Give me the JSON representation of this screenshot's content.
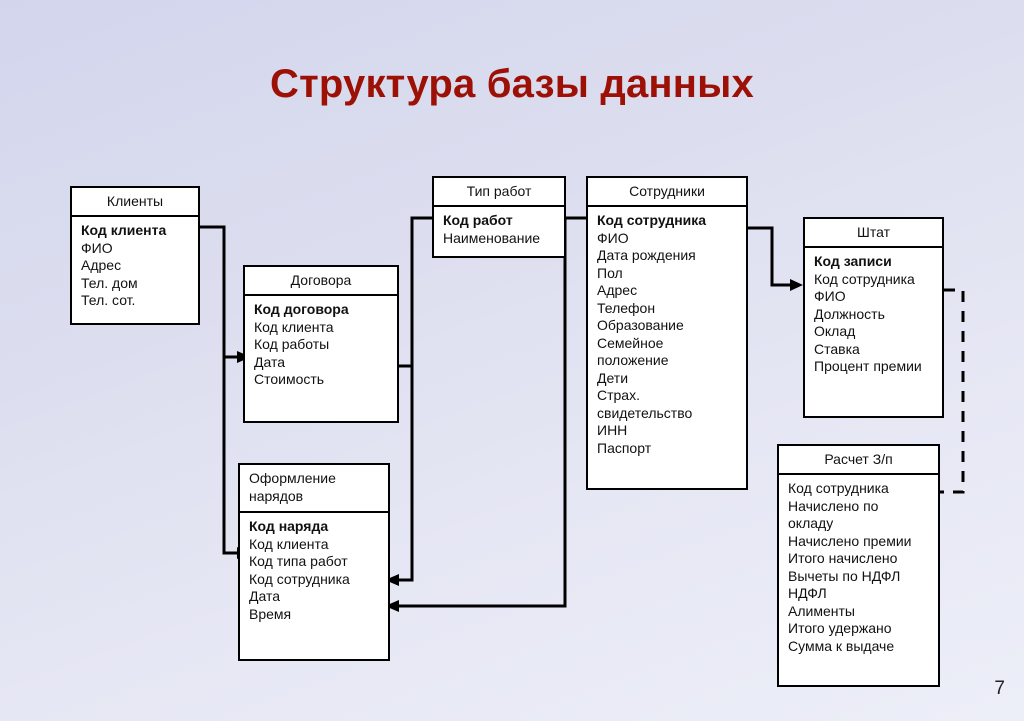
{
  "slide": {
    "title": "Структура базы данных",
    "page_number": "7",
    "title_color": "#9c1006",
    "background_color": "#dcdeef",
    "box_border_color": "#000000",
    "box_fill_color": "#ffffff"
  },
  "entities": [
    {
      "id": "klienty",
      "title": "Клиенты",
      "fields": [
        {
          "label": "Код клиента",
          "pk": true
        },
        {
          "label": "ФИО",
          "pk": false
        },
        {
          "label": "Адрес",
          "pk": false
        },
        {
          "label": "Тел. дом",
          "pk": false
        },
        {
          "label": "Тел. сот.",
          "pk": false
        }
      ]
    },
    {
      "id": "dogovora",
      "title": "Договора",
      "fields": [
        {
          "label": "Код договора",
          "pk": true
        },
        {
          "label": "Код клиента",
          "pk": false
        },
        {
          "label": "Код работы",
          "pk": false
        },
        {
          "label": "Дата",
          "pk": false
        },
        {
          "label": "Стоимость",
          "pk": false
        }
      ]
    },
    {
      "id": "tip-rabot",
      "title": "Тип работ",
      "fields": [
        {
          "label": "Код работ",
          "pk": true
        },
        {
          "label": "Наименование",
          "pk": false
        }
      ]
    },
    {
      "id": "sotrudniki",
      "title": "Сотрудники",
      "fields": [
        {
          "label": "Код сотрудника",
          "pk": true
        },
        {
          "label": "ФИО",
          "pk": false
        },
        {
          "label": "Дата рождения",
          "pk": false
        },
        {
          "label": "Пол",
          "pk": false
        },
        {
          "label": "Адрес",
          "pk": false
        },
        {
          "label": "Телефон",
          "pk": false
        },
        {
          "label": "Образование",
          "pk": false
        },
        {
          "label": "Семейное положение",
          "pk": false,
          "wrap": true
        },
        {
          "label": "Дети",
          "pk": false
        },
        {
          "label": "Страх. свидетельство",
          "pk": false,
          "wrap": true
        },
        {
          "label": "ИНН",
          "pk": false
        },
        {
          "label": "Паспорт",
          "pk": false
        }
      ]
    },
    {
      "id": "shtat",
      "title": "Штат",
      "fields": [
        {
          "label": "Код записи",
          "pk": true
        },
        {
          "label": "Код сотрудника",
          "pk": false
        },
        {
          "label": "ФИО",
          "pk": false
        },
        {
          "label": "Должность",
          "pk": false
        },
        {
          "label": "Оклад",
          "pk": false
        },
        {
          "label": "Ставка",
          "pk": false
        },
        {
          "label": "Процент премии",
          "pk": false
        }
      ]
    },
    {
      "id": "oformlenie",
      "title": "Оформление нарядов",
      "fields": [
        {
          "label": "Код наряда",
          "pk": true
        },
        {
          "label": "Код клиента",
          "pk": false
        },
        {
          "label": "Код типа работ",
          "pk": false
        },
        {
          "label": "Код сотрудника",
          "pk": false
        },
        {
          "label": "Дата",
          "pk": false
        },
        {
          "label": "Время",
          "pk": false
        }
      ]
    },
    {
      "id": "raschet-zp",
      "title": "Расчет З/п",
      "fields": [
        {
          "label": "Код сотрудника",
          "pk": false
        },
        {
          "label": "Начислено по окладу",
          "pk": false,
          "wrap": true
        },
        {
          "label": "Начислено премии",
          "pk": false
        },
        {
          "label": "Итого начислено",
          "pk": false
        },
        {
          "label": "Вычеты по НДФЛ",
          "pk": false
        },
        {
          "label": "НДФЛ",
          "pk": false
        },
        {
          "label": "Алименты",
          "pk": false
        },
        {
          "label": "Итого удержано",
          "pk": false
        },
        {
          "label": "Сумма к выдаче",
          "pk": false
        }
      ]
    }
  ],
  "relations": [
    {
      "from": "klienty",
      "to": "dogovora",
      "style": "solid"
    },
    {
      "from": "klienty",
      "to": "oformlenie",
      "style": "solid"
    },
    {
      "from": "tip-rabot",
      "to": "dogovora",
      "style": "solid"
    },
    {
      "from": "tip-rabot",
      "to": "oformlenie",
      "style": "solid"
    },
    {
      "from": "sotrudniki",
      "to": "oformlenie",
      "style": "solid"
    },
    {
      "from": "sotrudniki",
      "to": "shtat",
      "style": "solid"
    },
    {
      "from": "shtat",
      "to": "raschet-zp",
      "style": "dashed"
    }
  ]
}
